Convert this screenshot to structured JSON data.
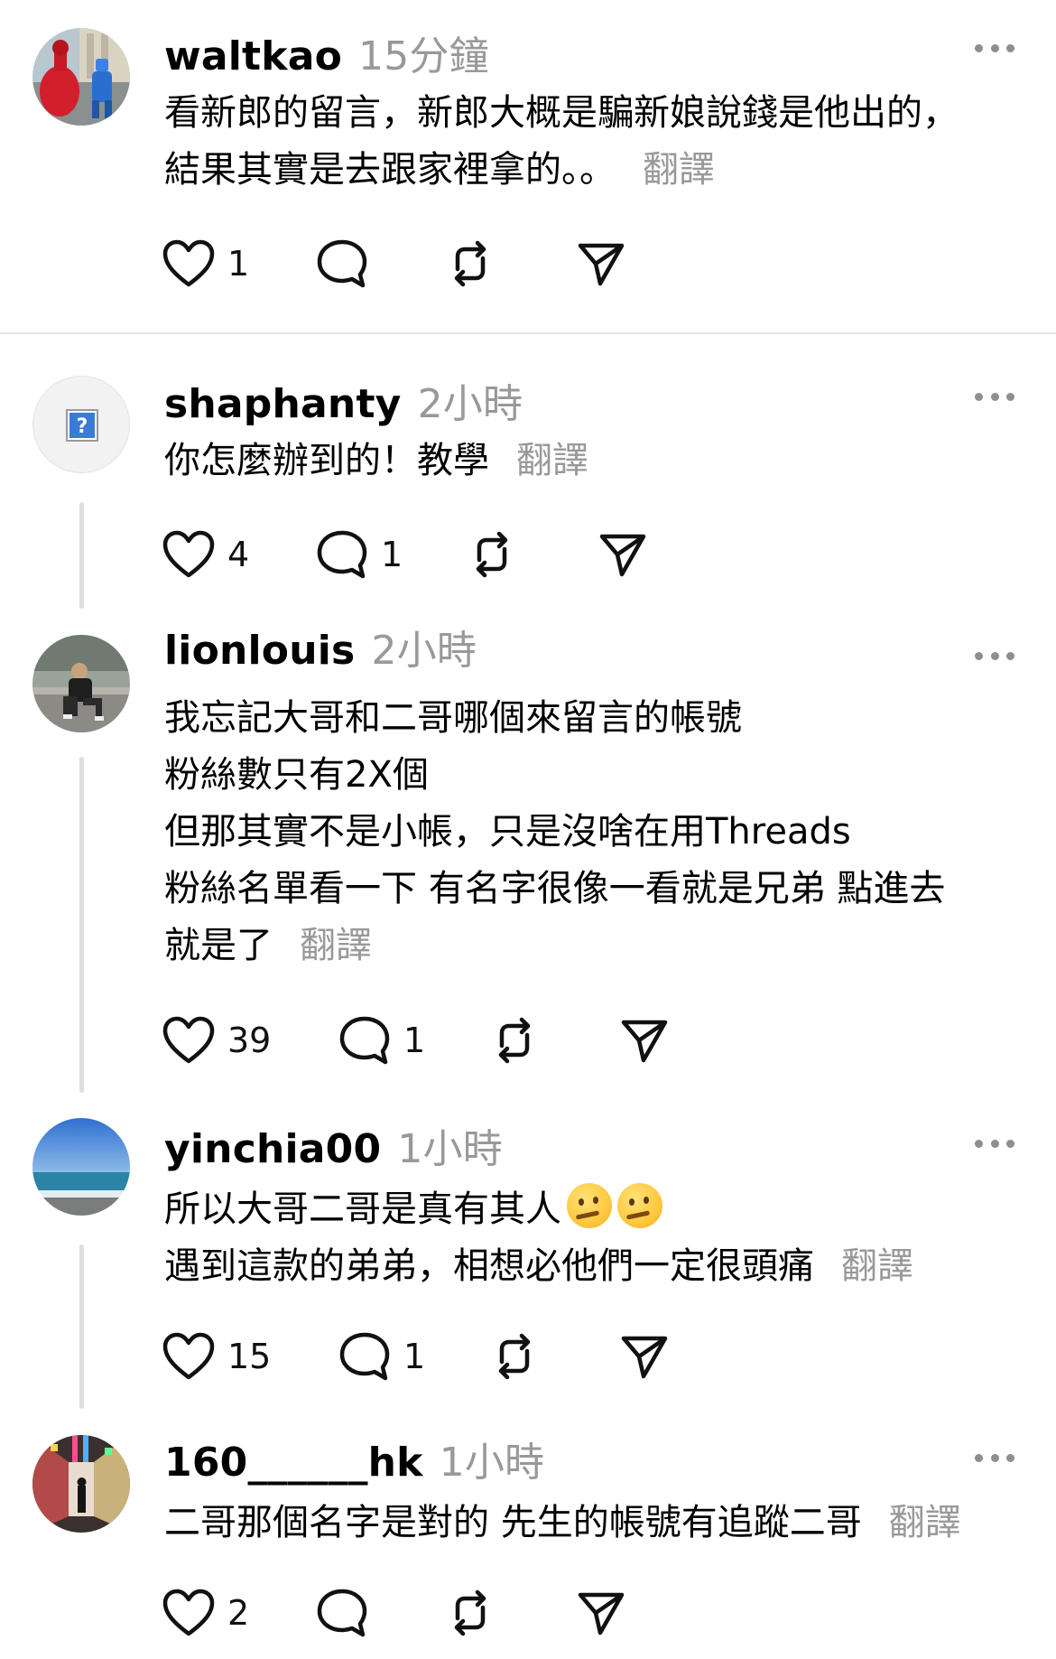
{
  "translate_label": "翻譯",
  "posts": [
    {
      "username": "waltkao",
      "time": "15分鐘",
      "lines": [
        "看新郎的留言，新郎大概是騙新娘說錢是他出的，",
        "結果其實是去跟家裡拿的。。"
      ],
      "likes": "1",
      "replies": "",
      "avatar": "photo-red-blue-robot-statues"
    },
    {
      "username": "shaphanty",
      "time": "2小時",
      "lines": [
        "你怎麼辦到的！教學"
      ],
      "likes": "4",
      "replies": "1",
      "avatar": "placeholder-question-mark"
    },
    {
      "username": "lionlouis",
      "time": "2小時",
      "lines": [
        "我忘記大哥和二哥哪個來留言的帳號",
        "粉絲數只有2X個",
        "但那其實不是小帳，只是沒啥在用Threads",
        "粉絲名單看一下 有名字很像一看就是兄弟 點進去",
        "就是了"
      ],
      "likes": "39",
      "replies": "1",
      "avatar": "photo-man-sitting-outdoors"
    },
    {
      "username": "yinchia00",
      "time": "1小時",
      "lines": [
        "所以大哥二哥是真有其人",
        "遇到這款的弟弟，相想必他們一定很頭痛"
      ],
      "emoji": "thinking-face-emoji",
      "likes": "15",
      "replies": "1",
      "avatar": "photo-sea-horizon"
    },
    {
      "username": "160______hk",
      "time": "1小時",
      "lines": [
        "二哥那個名字是對的 先生的帳號有追蹤二哥"
      ],
      "likes": "2",
      "replies": "",
      "avatar": "photo-person-in-colorful-hallway"
    }
  ]
}
